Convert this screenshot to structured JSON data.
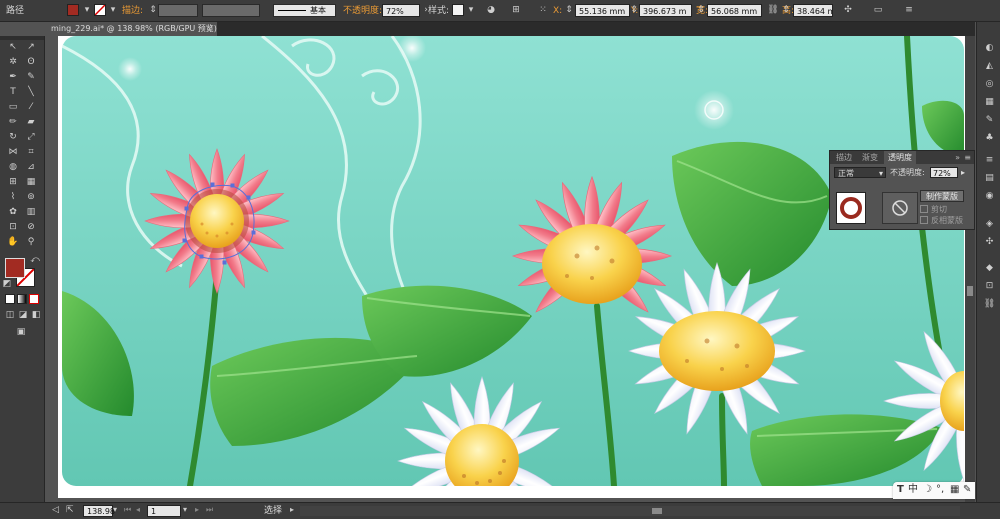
{
  "control_bar": {
    "selection_label": "路径",
    "stroke_label": "描边:",
    "brush_label": "基本",
    "opacity_label": "不透明度:",
    "opacity_value": "72%",
    "style_label": "样式:",
    "x_label": "X:",
    "x_value": "55.136 mm",
    "y_label": "Y:",
    "y_value": "396.673 m",
    "width_label": "宽:",
    "width_value": "56.068 mm",
    "height_label": "高:",
    "height_value": "38.464 mm",
    "fill_color": "#a22b22",
    "accent_label_color": "#e99a35"
  },
  "document": {
    "tab_title": "ming_229.ai* @ 138.98% (RGB/GPU 预览)"
  },
  "colors": {
    "sky": "#7dd8c8",
    "petal_pink": "#f08a96",
    "petal_white": "#ffffff",
    "flower_center": "#f7c23a",
    "leaf": "#3b9a3a",
    "stem": "#2f8a2f",
    "selection_path": "#5a6fd8"
  },
  "transparency_panel": {
    "tabs": [
      "描边",
      "渐变",
      "透明度"
    ],
    "active_tab": "透明度",
    "blend_mode": "正常",
    "opacity_label": "不透明度:",
    "opacity_value": "72%",
    "make_mask_button": "制作蒙版",
    "clip_label": "剪切",
    "invert_mask_label": "反相蒙版"
  },
  "status_bar": {
    "zoom": "138.98",
    "artboard_number": "1",
    "tool_name": "选择"
  },
  "quick_panel": {
    "text_icon": "T",
    "chinese_label": "中"
  },
  "icons": {
    "tools": [
      "selection-arrow",
      "direct-selection-arrow",
      "magic-wand",
      "lasso",
      "pen",
      "curvature-pen",
      "type",
      "line-segment",
      "rectangle",
      "paintbrush",
      "pencil",
      "shaper",
      "rotate",
      "scale",
      "width",
      "warp",
      "free-transform",
      "shape-builder",
      "perspective-grid",
      "mesh",
      "gradient",
      "eyedropper",
      "blend",
      "symbol-sprayer",
      "column-graph",
      "artboard",
      "slice",
      "eraser",
      "hand",
      "zoom"
    ],
    "right_panels": [
      "color-panel",
      "color-guide",
      "appearance",
      "graphic-styles",
      "brushes",
      "symbols",
      "swatches",
      "stroke",
      "gradient",
      "transparency",
      "layers",
      "artboards",
      "links"
    ]
  }
}
